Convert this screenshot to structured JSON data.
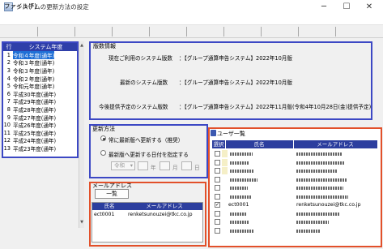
{
  "window": {
    "title": "システムの更新方法の設定",
    "min": "─",
    "max": "☐",
    "close": "✕"
  },
  "menu": {
    "file": "ファイル(F)"
  },
  "year_list": {
    "header_num": "行",
    "header_name": "システム年度",
    "rows": [
      {
        "num": "1",
        "name": "令和４年度(通年)"
      },
      {
        "num": "2",
        "name": "令和３年度(通年)"
      },
      {
        "num": "3",
        "name": "令和３年度(通年)"
      },
      {
        "num": "4",
        "name": "令和２年度(通年)"
      },
      {
        "num": "5",
        "name": "令和元年度(通年)"
      },
      {
        "num": "6",
        "name": "平成30年度(通年)"
      },
      {
        "num": "7",
        "name": "平成29年度(通年)"
      },
      {
        "num": "8",
        "name": "平成28年度(通年)"
      },
      {
        "num": "9",
        "name": "平成27年度(通年)"
      },
      {
        "num": "10",
        "name": "平成26年度(通年)"
      },
      {
        "num": "11",
        "name": "平成25年度(通年)"
      },
      {
        "num": "12",
        "name": "平成24年度(通年)"
      },
      {
        "num": "13",
        "name": "平成23年度(通年)"
      }
    ],
    "selected_row": 1
  },
  "version_info": {
    "title": "版数情報",
    "current_label": "現在ご利用のシステム版数",
    "current_value": "：【グループ通算申告システム】2022年10月版",
    "latest_label": "最新のシステム版数",
    "latest_value": "：【グループ通算申告システム】2022年10月版",
    "future_label": "今後提供予定のシステム版数",
    "future_value": "：【グループ通算申告システム】2022年11月版(令和4年10月28日(金)提供予定)"
  },
  "update_method": {
    "title": "更新方法",
    "option_always": "常に最新版へ更新する（推奨）",
    "option_date": "最新版へ更新する日付を指定する",
    "era": "令和",
    "year_unit": "年",
    "month_unit": "月",
    "day_unit": "日",
    "selected": "always"
  },
  "mail": {
    "title": "メールアドレス",
    "list_button": "一覧",
    "col_name": "氏名",
    "col_email": "メールアドレス",
    "rows": [
      {
        "name": "ect0001",
        "email": "renketsunouzei@tkc.co.jp"
      }
    ]
  },
  "user_dialog": {
    "title": "ユーザ一覧",
    "col_select": "選択",
    "col_name": "氏名",
    "col_email": "メールアドレス",
    "visible_name": "ect0001",
    "visible_email": "renketsunouzei@tkc.co.jp",
    "checked_row": 7,
    "row_count": 10
  },
  "colors": {
    "accent_blue": "#2c3e9e",
    "highlight_orange": "#e2502a",
    "selection": "#1f6fd6"
  }
}
